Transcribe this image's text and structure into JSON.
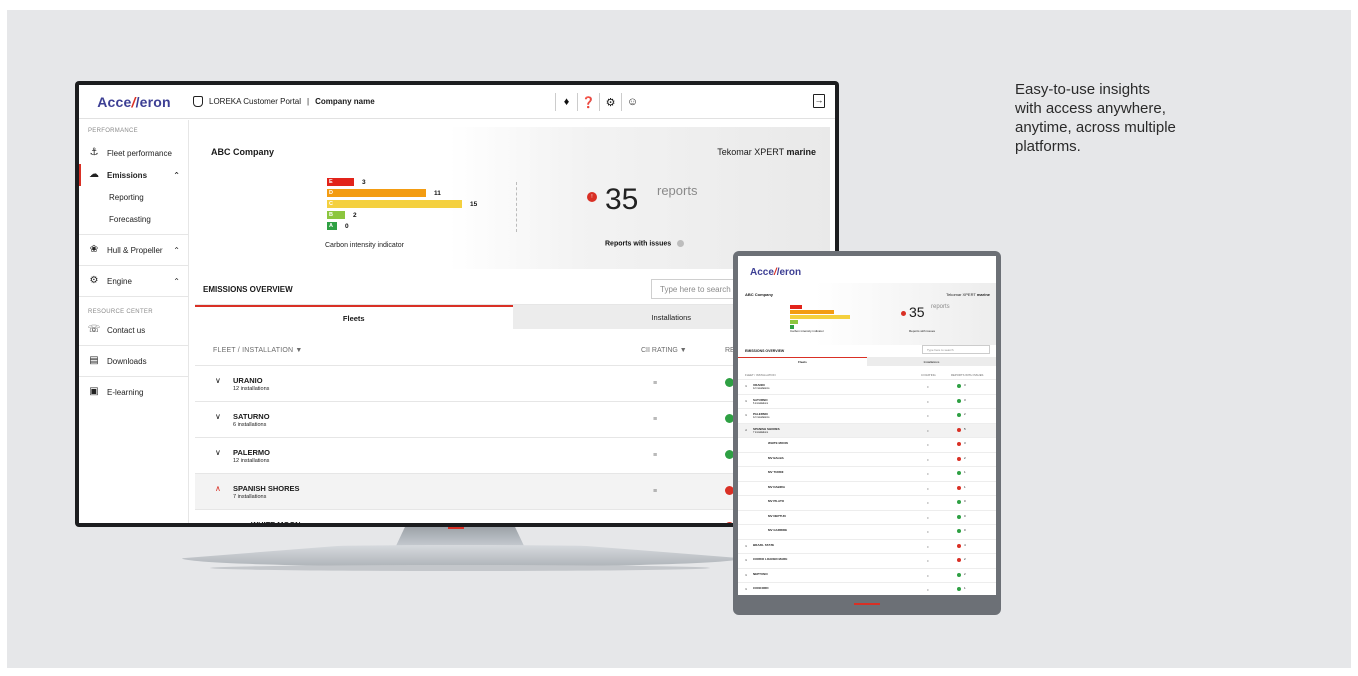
{
  "tagline": [
    "Easy-to-use insights",
    "with access anywhere,",
    "anytime, across multiple",
    "platforms."
  ],
  "brand": {
    "logo_pre": "Acce",
    "logo_slash": "/",
    "logo_post": "/eron",
    "accent": "#d93025",
    "brand_blue": "#3d3f94"
  },
  "topbar": {
    "portal_label": "LOREKA Customer Portal",
    "company": "Company name",
    "icons": [
      "bell-icon",
      "help-icon",
      "gear-icon",
      "user-icon"
    ]
  },
  "sidebar": {
    "section_performance": "PERFORMANCE",
    "fleet_performance": "Fleet performance",
    "emissions": "Emissions",
    "reporting": "Reporting",
    "forecasting": "Forecasting",
    "hull_propeller": "Hull & Propeller",
    "engine": "Engine",
    "section_resource": "RESOURCE CENTER",
    "contact_us": "Contact us",
    "downloads": "Downloads",
    "elearning": "E-learning"
  },
  "hero": {
    "company": "ABC Company",
    "product_pre": "Tekomar XPERT",
    "product_bold": "marine",
    "cii_label": "Carbon intensity indicator",
    "reports_count": "35",
    "reports_word": "reports",
    "reports_issues": "Reports with issues"
  },
  "chart_data": {
    "type": "bar",
    "categories": [
      "E",
      "D",
      "C",
      "B",
      "A"
    ],
    "values": [
      3,
      11,
      15,
      2,
      0
    ],
    "colors": [
      "#e2231a",
      "#f39c12",
      "#f4d03f",
      "#8cc63e",
      "#2ea043"
    ]
  },
  "overview": {
    "title": "EMISSIONS OVERVIEW",
    "search_placeholder": "Type here to search",
    "tab_fleets": "Fleets",
    "tab_installations": "Installations",
    "col_fleet": "FLEET / INSTALLATION",
    "col_cii": "CII RATING",
    "col_re": "RE"
  },
  "rows": [
    {
      "name": "URANIO",
      "sub": "12 installations",
      "chev": "∨",
      "status": "#2ea043",
      "expanded": false
    },
    {
      "name": "SATURNO",
      "sub": "6 installations",
      "chev": "∨",
      "status": "#2ea043",
      "expanded": false
    },
    {
      "name": "PALERMO",
      "sub": "12 installations",
      "chev": "∨",
      "status": "#2ea043",
      "expanded": false
    },
    {
      "name": "SPANISH SHORES",
      "sub": "7 installations",
      "chev": "∧",
      "status": "#d93025",
      "expanded": true
    },
    {
      "name": "WHITE MOON",
      "sub": "",
      "chev": "",
      "status": "#d93025",
      "expanded": false
    }
  ],
  "tablet": {
    "company": "ABC Company",
    "product_pre": "Tekomar XPERT",
    "product_bold": "marine",
    "reports_count": "35",
    "reports_word": "reports",
    "cii_label": "Carbon intensity indicator",
    "reports_issues": "Reports with issues",
    "overview_title": "EMISSIONS OVERVIEW",
    "search_placeholder": "Type here to search",
    "tab_fleets": "Fleets",
    "tab_installations": "Installations",
    "col_fleet": "FLEET / INSTALLATION",
    "col_cii": "CII RATING",
    "col_reports": "REPORTS WITH ISSUES",
    "rows": [
      {
        "name": "URANIO",
        "sub": "12 installations",
        "child": false,
        "status": "#2ea043",
        "val": "3"
      },
      {
        "name": "SATURNO",
        "sub": "6 installations",
        "child": false,
        "status": "#2ea043",
        "val": "3"
      },
      {
        "name": "PALERMO",
        "sub": "12 installations",
        "child": false,
        "status": "#2ea043",
        "val": "2"
      },
      {
        "name": "SPANISH SHORES",
        "sub": "7 installations",
        "child": false,
        "status": "#d93025",
        "val": "5",
        "expanded": true
      },
      {
        "name": "WHITE MOON",
        "sub": "",
        "child": true,
        "status": "#d93025",
        "val": "3"
      },
      {
        "name": "MV BALBA",
        "sub": "",
        "child": true,
        "status": "#d93025",
        "val": "2"
      },
      {
        "name": "MV TURINI",
        "sub": "",
        "child": true,
        "status": "#2ea043",
        "val": "1"
      },
      {
        "name": "MV DABIRA",
        "sub": "",
        "child": true,
        "status": "#d93025",
        "val": "1"
      },
      {
        "name": "MV PILATO",
        "sub": "",
        "child": true,
        "status": "#2ea043",
        "val": "0"
      },
      {
        "name": "MV NEPTUN",
        "sub": "",
        "child": true,
        "status": "#2ea043",
        "val": "0"
      },
      {
        "name": "MV GARRIDE",
        "sub": "",
        "child": true,
        "status": "#2ea043",
        "val": "0"
      },
      {
        "name": "BRAZIL STATE",
        "sub": "",
        "child": false,
        "status": "#d93025",
        "val": "4"
      },
      {
        "name": "CORDO LOADED MARE",
        "sub": "",
        "child": false,
        "status": "#d93025",
        "val": "2"
      },
      {
        "name": "NEPTUNO",
        "sub": "",
        "child": false,
        "status": "#2ea043",
        "val": "2"
      },
      {
        "name": "CONCORD",
        "sub": "",
        "child": false,
        "status": "#2ea043",
        "val": "1"
      }
    ]
  }
}
